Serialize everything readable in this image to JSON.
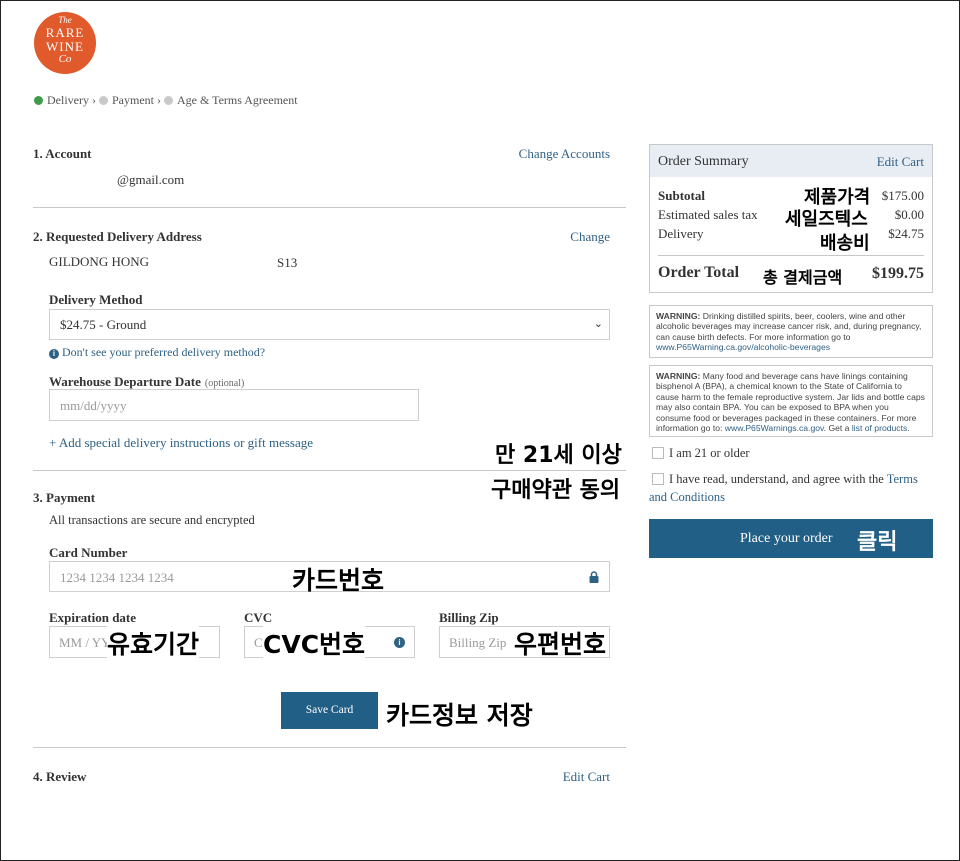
{
  "brand": {
    "logo_lines": [
      "The",
      "RARE",
      "WINE",
      "Co"
    ],
    "color": "#e05a2b"
  },
  "breadcrumb": [
    {
      "label": "Delivery",
      "status": "done"
    },
    {
      "label": "Payment",
      "status": "pending"
    },
    {
      "label": "Age & Terms Agreement",
      "status": "pending"
    }
  ],
  "account": {
    "heading": "1. Account",
    "change_link": "Change Accounts",
    "email": "@gmail.com"
  },
  "delivery": {
    "heading": "2. Requested Delivery Address",
    "change_link": "Change",
    "name": "GILDONG HONG",
    "address_suffix": "S13",
    "method_label": "Delivery Method",
    "method_value": "$24.75 - Ground",
    "method_help": "Don't see your preferred delivery method?",
    "date_label": "Warehouse Departure Date",
    "date_optional": "(optional)",
    "date_placeholder": "mm/dd/yyyy",
    "instructions_link": "+ Add special delivery instructions or gift message"
  },
  "payment": {
    "heading": "3. Payment",
    "secure_note": "All transactions are secure and encrypted",
    "card_label": "Card Number",
    "card_placeholder": "1234 1234 1234 1234",
    "exp_label": "Expiration date",
    "exp_placeholder": "MM / YY",
    "cvc_label": "CVC",
    "cvc_placeholder": "CVC",
    "zip_label": "Billing Zip",
    "zip_placeholder": "Billing Zip",
    "save_button": "Save Card"
  },
  "review": {
    "heading": "4. Review",
    "edit_link": "Edit Cart"
  },
  "summary": {
    "title": "Order Summary",
    "edit_link": "Edit Cart",
    "subtotal_label": "Subtotal",
    "subtotal_value": "$175.00",
    "tax_label": "Estimated sales tax",
    "tax_value": "$0.00",
    "delivery_label": "Delivery",
    "delivery_value": "$24.75",
    "total_label": "Order Total",
    "total_value": "$199.75"
  },
  "warnings": {
    "w1_title": "WARNING:",
    "w1_text": "Drinking distilled spirits, beer, coolers, wine and other alcoholic beverages may increase cancer risk, and, during pregnancy, can cause birth defects. For more information go to",
    "w1_link": "www.P65Warning.ca.gov/alcoholic-beverages",
    "w2_title": "WARNING:",
    "w2_text": "Many food and beverage cans have linings containing bisphenol A (BPA), a chemical known to the State of California to cause harm to the female reproductive system. Jar lids and bottle caps may also contain BPA. You can be exposed to BPA when you consume food or beverages packaged in these containers. For more information go to:",
    "w2_link": "www.P65Warnings.ca.gov",
    "w2_tail": ". Get a",
    "w2_link2": "list of products",
    "w2_end": "."
  },
  "agreement": {
    "age_label": "I am 21 or older",
    "terms_prefix": "I have read, understand, and agree with the",
    "terms_link_1": "Terms",
    "terms_link_2": "and Conditions",
    "place_order": "Place your order"
  },
  "annotations": {
    "product_price": "제품가격",
    "sales_tax": "세일즈텍스",
    "shipping": "배송비",
    "total": "총 결제금액",
    "age_over": "만 21세 이상",
    "purchase_terms": "구매약관 동의",
    "click": "클릭",
    "card_number": "카드번호",
    "expiry": "유효기간",
    "cvc_number": "CVC번호",
    "zip": "우편번호",
    "save_card_info": "카드정보 저장"
  },
  "colors": {
    "accent": "#2f6185",
    "button": "#225f86",
    "summary_header": "#e8edf4",
    "check": "#3f9a4a"
  }
}
